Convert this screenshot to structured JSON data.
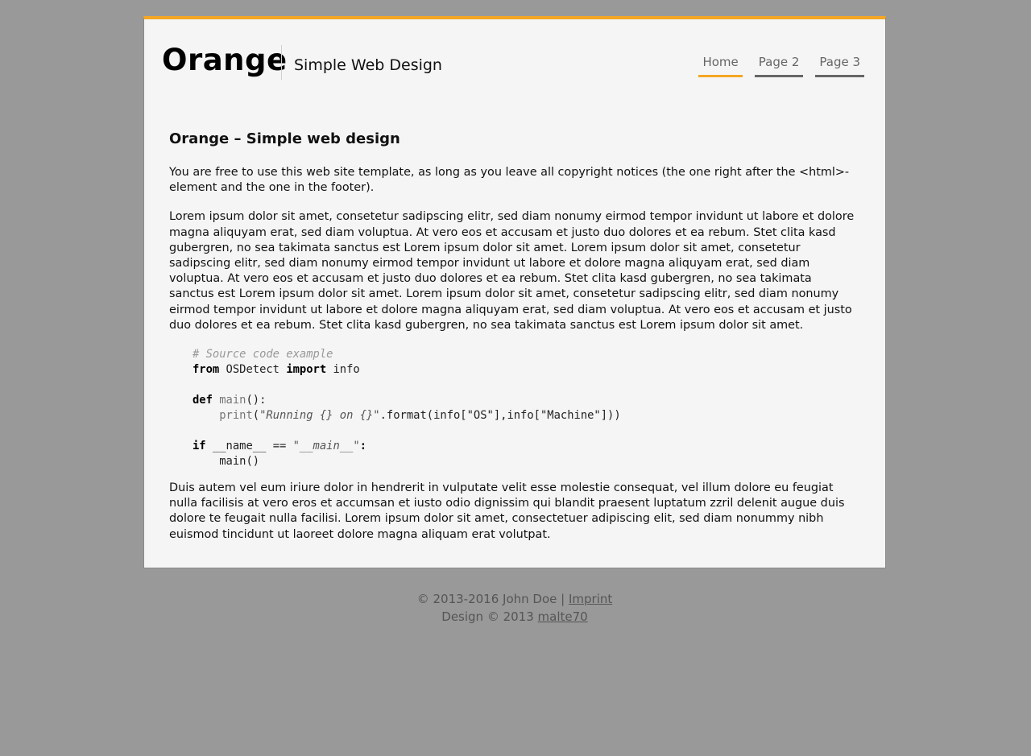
{
  "header": {
    "logo": "Orange",
    "tagline": "Simple Web Design"
  },
  "nav": {
    "items": [
      {
        "label": "Home",
        "active": true
      },
      {
        "label": "Page 2",
        "active": false
      },
      {
        "label": "Page 3",
        "active": false
      }
    ]
  },
  "main": {
    "title": "Orange – Simple web design",
    "paragraph1": "You are free to use this web site template, as long as you leave all copyright notices (the one right after the <html>-element and the one in the footer).",
    "paragraph2": "Lorem ipsum dolor sit amet, consetetur sadipscing elitr, sed diam nonumy eirmod tempor invidunt ut labore et dolore magna aliquyam erat, sed diam voluptua. At vero eos et accusam et justo duo dolores et ea rebum. Stet clita kasd gubergren, no sea takimata sanctus est Lorem ipsum dolor sit amet. Lorem ipsum dolor sit amet, consetetur sadipscing elitr, sed diam nonumy eirmod tempor invidunt ut labore et dolore magna aliquyam erat, sed diam voluptua. At vero eos et accusam et justo duo dolores et ea rebum. Stet clita kasd gubergren, no sea takimata sanctus est Lorem ipsum dolor sit amet. Lorem ipsum dolor sit amet, consetetur sadipscing elitr, sed diam nonumy eirmod tempor invidunt ut labore et dolore magna aliquyam erat, sed diam voluptua. At vero eos et accusam et justo duo dolores et ea rebum. Stet clita kasd gubergren, no sea takimata sanctus est Lorem ipsum dolor sit amet.",
    "code": {
      "comment": "# Source code example",
      "kw_from": "from",
      "module": " OSDetect ",
      "kw_import": "import",
      "import_name": " info",
      "kw_def": "def",
      "func_main": "main",
      "def_rest": "():",
      "print_fn": "print",
      "print_open": "(",
      "print_str": "\"Running {} on {}\"",
      "print_rest": ".format(info[\"OS\"],info[\"Machine\"]))",
      "kw_if": "if",
      "if_rest": " __name__ == ",
      "if_str": "\"__main__\"",
      "if_colon": ":",
      "call_main": "main()"
    },
    "paragraph3": "Duis autem vel eum iriure dolor in hendrerit in vulputate velit esse molestie consequat, vel illum dolore eu feugiat nulla facilisis at vero eros et accumsan et iusto odio dignissim qui blandit praesent luptatum zzril delenit augue duis dolore te feugait nulla facilisi. Lorem ipsum dolor sit amet, consectetuer adipiscing elit, sed diam nonummy nibh euismod tincidunt ut laoreet dolore magna aliquam erat volutpat."
  },
  "footer": {
    "copyright": "© 2013-2016 John Doe | ",
    "imprint_link": "Imprint",
    "design_text": "Design © 2013 ",
    "designer_link": "malte70"
  },
  "colors": {
    "accent": "#f5a623",
    "background": "#999999",
    "page": "#f5f5f5"
  }
}
